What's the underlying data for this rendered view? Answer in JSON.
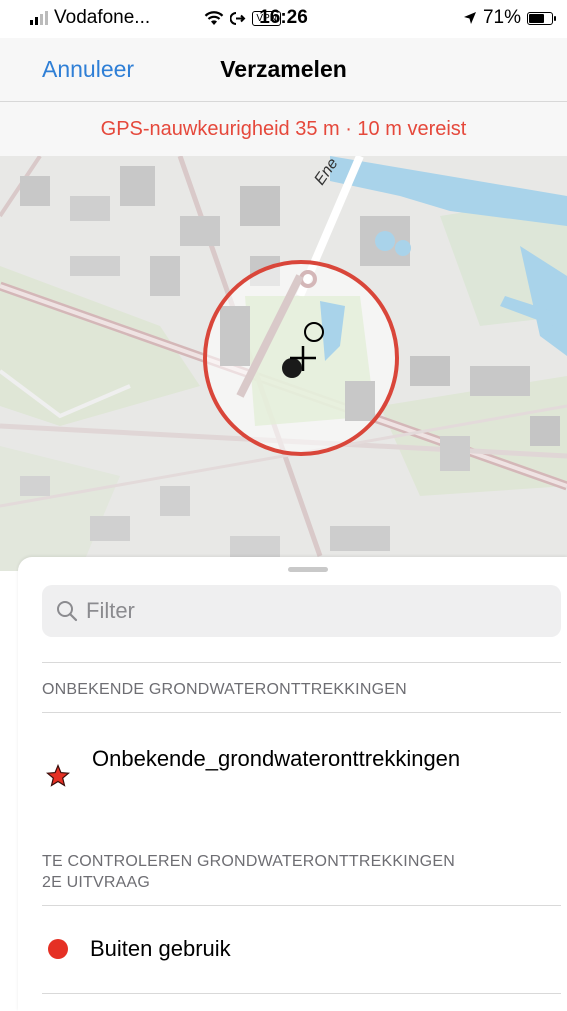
{
  "status_bar": {
    "carrier": "Vodafone...",
    "vpn": "VPN",
    "time": "16:26",
    "battery_percent": "71%",
    "battery_level": 0.71
  },
  "nav": {
    "cancel": "Annuleer",
    "title": "Verzamelen"
  },
  "gps_banner": "GPS-nauwkeurigheid 35 m · 10 m vereist",
  "map": {
    "street_label": "Ene"
  },
  "filter": {
    "placeholder": "Filter"
  },
  "sections": [
    {
      "header": "ONBEKENDE GRONDWATERONTTREKKINGEN",
      "items": [
        {
          "label": "Onbekende_grondwateronttrekkingen",
          "symbol": "red-star",
          "color": "#e53024"
        }
      ]
    },
    {
      "header_line1": "TE CONTROLEREN GRONDWATERONTTREKKINGEN",
      "header_line2": "2E UITVRAAG",
      "items": [
        {
          "label": "Buiten gebruik",
          "symbol": "red-dot",
          "color": "#e53024"
        }
      ]
    }
  ],
  "colors": {
    "accent": "#2f7fd6",
    "warning": "#e5483b",
    "accuracy_circle": "#d9463a"
  }
}
